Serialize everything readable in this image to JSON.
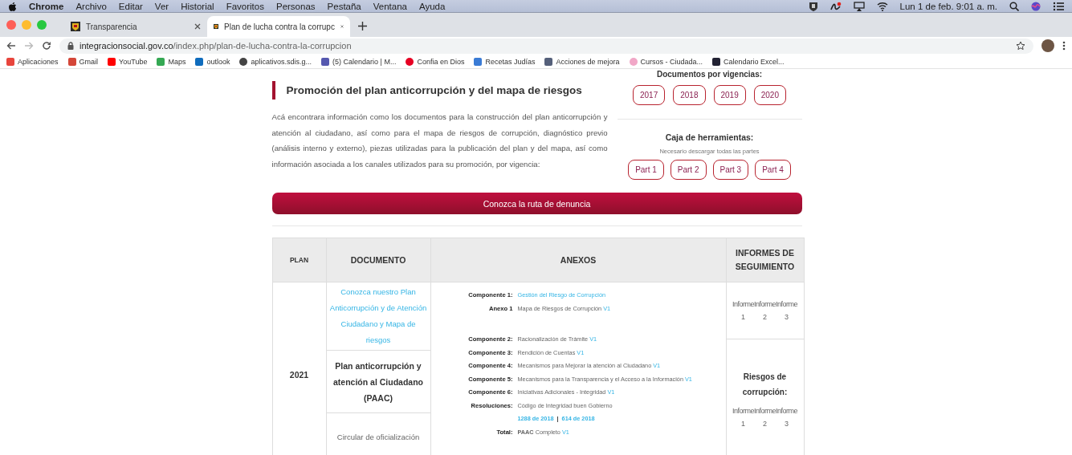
{
  "menubar": {
    "app": "Chrome",
    "menus": [
      "Archivo",
      "Editar",
      "Ver",
      "Historial",
      "Favoritos",
      "Personas",
      "Pestaña",
      "Ventana",
      "Ayuda"
    ],
    "clock": "Lun 1 de feb.  9:01 a. m."
  },
  "tabs": [
    {
      "title": "Transparencia",
      "selected": false
    },
    {
      "title": "Plan de lucha contra la corrupc",
      "selected": true
    }
  ],
  "address": {
    "host": "integracionsocial.gov.co",
    "path": "/index.php/plan-de-lucha-contra-la-corrupcion"
  },
  "bookmarks": [
    {
      "label": "Aplicaciones"
    },
    {
      "label": "Gmail"
    },
    {
      "label": "YouTube"
    },
    {
      "label": "Maps"
    },
    {
      "label": "outlook"
    },
    {
      "label": "aplicativos.sdis.g..."
    },
    {
      "label": "(5) Calendario | M..."
    },
    {
      "label": "Confia en Dios"
    },
    {
      "label": "Recetas Judías"
    },
    {
      "label": "Acciones de mejora"
    },
    {
      "label": "Cursos - Ciudada..."
    },
    {
      "label": "Calendario Excel..."
    }
  ],
  "page": {
    "heading": "Promoción del plan anticorrupción y del mapa de riesgos",
    "description": "Acá encontrara información como los documentos para la construcción del plan anticorrupción y atención al ciudadano, así como para el mapa de riesgos de corrupción, diagnóstico previo (análisis interno y externo), piezas utilizadas para la publicación del plan y del mapa, así como información asociada a los canales utilizados para su promoción, por vigencia:",
    "vigencias_title": "Documentos por vigencias:",
    "years": [
      "2017",
      "2018",
      "2019",
      "2020"
    ],
    "toolbox_title": "Caja de herramientas:",
    "toolbox_note": "Necesario descargar todas las partes",
    "parts": [
      "Part 1",
      "Part 2",
      "Part 3",
      "Part 4"
    ],
    "cta": "Conozca la ruta de denuncia"
  },
  "table": {
    "columns": [
      "PLAN",
      "DOCUMENTO",
      "ANEXOS",
      "INFORMES DE SEGUIMIENTO"
    ],
    "plan": "2021",
    "documents": [
      {
        "kind": "link",
        "text": "Conozca nuestro Plan Anticorrupción y de Atención Ciudadano y Mapa de riesgos"
      },
      {
        "kind": "bold",
        "text": "Plan anticorrupción y atención al Ciudadano (PAAC)"
      },
      {
        "kind": "plain",
        "text": "Circular de oficialización"
      }
    ],
    "annex_groups": [
      [
        {
          "kind": "link",
          "label": "Componente 1:",
          "text": "Gestión del Riesgo de Corrupción"
        },
        {
          "kind": "text",
          "label": "Anexo 1",
          "text": "Mapa de Riesgos de Corrupción",
          "version": "V1"
        }
      ],
      [
        {
          "kind": "text",
          "label": "Componente 2:",
          "text": "Racionalización de Trámite",
          "version": "V1"
        },
        {
          "kind": "text",
          "label": "Componente 3:",
          "text": "Rendición de Cuentas ",
          "version": "V1"
        },
        {
          "kind": "text",
          "label": "Componente 4:",
          "text": "Mecanismos para Mejorar la atención al Ciudadano",
          "version": "V1"
        },
        {
          "kind": "text",
          "label": "Componente 5:",
          "text": "Mecanismos para la Transparencia y el Acceso a la Información",
          "version": "V1"
        },
        {
          "kind": "text",
          "label": "Componente 6:",
          "text": "Iniciativas Adicionales - Integridad",
          "version": "V1"
        },
        {
          "kind": "text",
          "label": "Resoluciones:",
          "text": "Código de Integridad buen Gobierno"
        },
        {
          "kind": "links",
          "links": [
            "1288 de 2018",
            "614 de 2018"
          ],
          "separator": "|"
        },
        {
          "kind": "text",
          "label": "Total:",
          "text": "**PAAC** Completo",
          "version": "V1"
        }
      ]
    ],
    "reports": [
      {
        "items": [
          {
            "word": "Informe",
            "number": "1"
          },
          {
            "word": "Informe",
            "number": "2"
          },
          {
            "word": "Informe",
            "number": "3"
          }
        ]
      },
      {
        "title": "Riesgos de corrupción:",
        "items": [
          {
            "word": "Informe",
            "number": "1"
          },
          {
            "word": "Informe",
            "number": "2"
          },
          {
            "word": "Informe",
            "number": "3"
          }
        ]
      }
    ]
  }
}
